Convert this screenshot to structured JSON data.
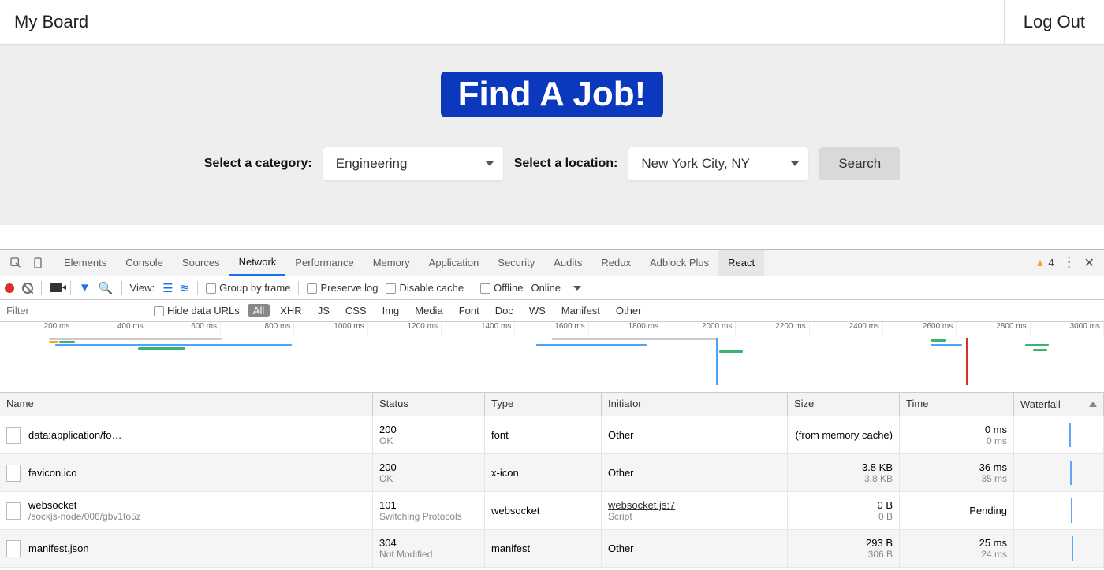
{
  "app": {
    "brand": "My Board",
    "logout": "Log Out",
    "hero_title": "Find A Job!",
    "category_label": "Select a category:",
    "category_value": "Engineering",
    "location_label": "Select a location:",
    "location_value": "New York City, NY",
    "search": "Search"
  },
  "devtools": {
    "tabs": [
      "Elements",
      "Console",
      "Sources",
      "Network",
      "Performance",
      "Memory",
      "Application",
      "Security",
      "Audits",
      "Redux",
      "Adblock Plus",
      "React"
    ],
    "active_tab": "Network",
    "selected_tab": "React",
    "warnings": "4",
    "toolbar": {
      "view_label": "View:",
      "group_by_frame": "Group by frame",
      "preserve_log": "Preserve log",
      "disable_cache": "Disable cache",
      "offline": "Offline",
      "online": "Online"
    },
    "filter": {
      "placeholder": "Filter",
      "hide_urls": "Hide data URLs",
      "types": [
        "All",
        "XHR",
        "JS",
        "CSS",
        "Img",
        "Media",
        "Font",
        "Doc",
        "WS",
        "Manifest",
        "Other"
      ],
      "active_type": "All"
    },
    "timeline_ticks": [
      "200 ms",
      "400 ms",
      "600 ms",
      "800 ms",
      "1000 ms",
      "1200 ms",
      "1400 ms",
      "1600 ms",
      "1800 ms",
      "2000 ms",
      "2200 ms",
      "2400 ms",
      "2600 ms",
      "2800 ms",
      "3000 ms"
    ],
    "columns": {
      "name": "Name",
      "status": "Status",
      "type": "Type",
      "initiator": "Initiator",
      "size": "Size",
      "time": "Time",
      "waterfall": "Waterfall"
    },
    "rows": [
      {
        "name": "data:application/fo…",
        "name2": "",
        "status": "200",
        "status2": "OK",
        "type": "font",
        "init": "Other",
        "init2": "",
        "size": "(from memory cache)",
        "size2": "",
        "time": "0 ms",
        "time2": "0 ms"
      },
      {
        "name": "favicon.ico",
        "name2": "",
        "status": "200",
        "status2": "OK",
        "type": "x-icon",
        "init": "Other",
        "init2": "",
        "size": "3.8 KB",
        "size2": "3.8 KB",
        "time": "36 ms",
        "time2": "35 ms"
      },
      {
        "name": "websocket",
        "name2": "/sockjs-node/006/gbv1to5z",
        "status": "101",
        "status2": "Switching Protocols",
        "type": "websocket",
        "init": "websocket.js:7",
        "init2": "Script",
        "size": "0 B",
        "size2": "0 B",
        "time": "Pending",
        "time2": ""
      },
      {
        "name": "manifest.json",
        "name2": "",
        "status": "304",
        "status2": "Not Modified",
        "type": "manifest",
        "init": "Other",
        "init2": "",
        "size": "293 B",
        "size2": "306 B",
        "time": "25 ms",
        "time2": "24 ms"
      }
    ]
  }
}
